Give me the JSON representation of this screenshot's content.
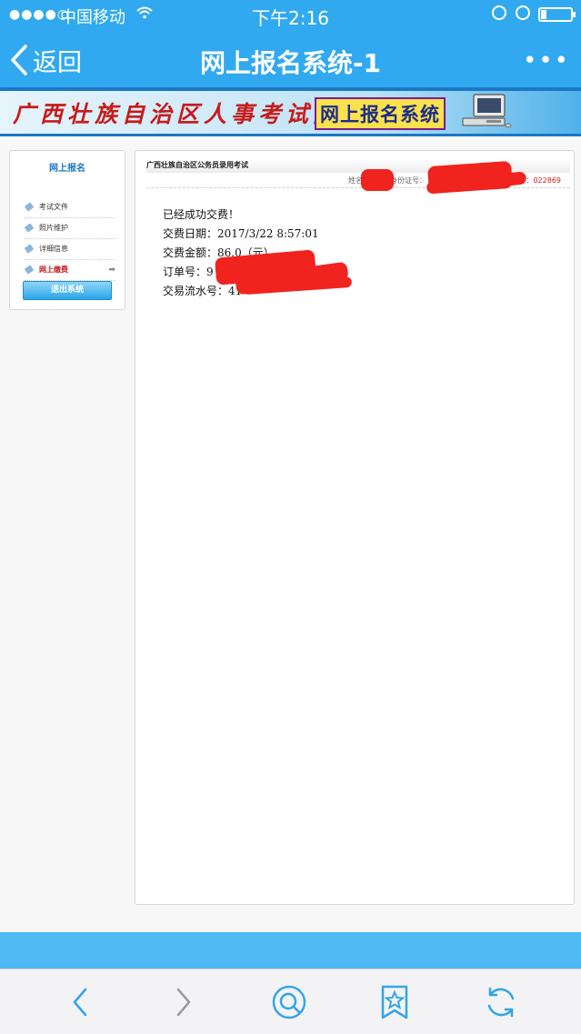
{
  "status_bar": {
    "signal": "●●●●○",
    "carrier": "中国移动",
    "time": "下午2:16"
  },
  "nav": {
    "back_label": "返回",
    "title": "网上报名系统-1",
    "more_label": "•••"
  },
  "banner": {
    "org_name": "广西壮族自治区人事考试院",
    "system_name": "网上报名系统"
  },
  "sidebar": {
    "heading": "网上报名",
    "items": [
      {
        "label": "考试文件"
      },
      {
        "label": "照片维护"
      },
      {
        "label": "详细信息"
      },
      {
        "label": "网上缴费"
      }
    ],
    "logout_label": "退出系统"
  },
  "main": {
    "exam_title": "广西壮族自治区公务员录用考试",
    "name_label": "姓名：",
    "id_label": "身份证号：",
    "seq_label": "报名序号：",
    "seq_value": "022869"
  },
  "receipt": {
    "status": "已经成功交费！",
    "date_label": "交费日期：",
    "date_value": "2017/3/22 8:57:01",
    "amount_label": "交费金额：",
    "amount_value": "86.0（元）",
    "order_label": "订单号：",
    "order_value": "9",
    "txn_label": "交易流水号：",
    "txn_value": "41"
  },
  "colors": {
    "ios_blue": "#31a9f0",
    "accent_red": "#d21b1b",
    "link_blue": "#1b77c4"
  }
}
